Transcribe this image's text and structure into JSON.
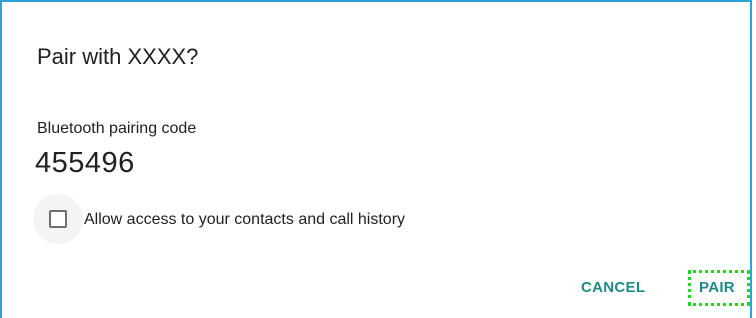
{
  "dialog": {
    "title": "Pair with XXXX?",
    "code_label": "Bluetooth pairing code",
    "code_value": "455496",
    "checkbox": {
      "label": "Allow access to your contacts and call history",
      "checked": false
    },
    "buttons": {
      "cancel": "CANCEL",
      "pair": "PAIR"
    }
  },
  "colors": {
    "accent": "#1f8a84",
    "frame": "#2aa5d6",
    "focus_highlight": "#22d622"
  }
}
